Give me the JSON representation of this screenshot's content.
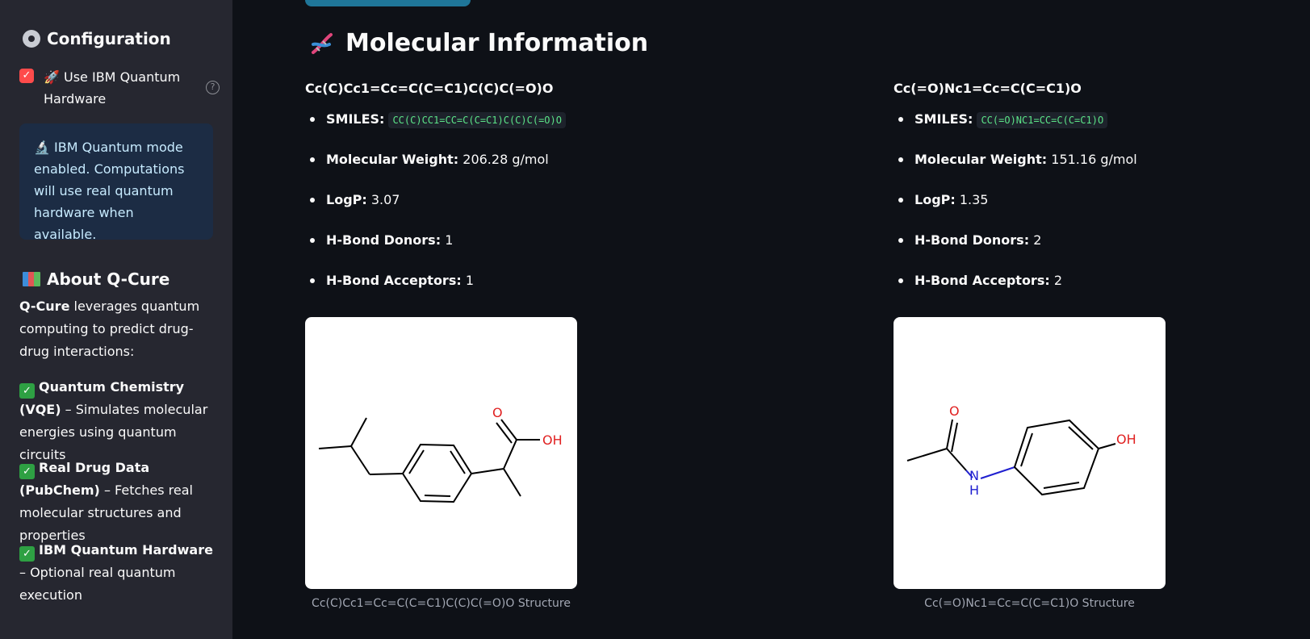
{
  "sidebar": {
    "config_title": "Configuration",
    "checkbox_label": "🚀 Use IBM Quantum Hardware",
    "checkbox_checked": true,
    "info_text": "🔬 IBM Quantum mode enabled. Computations will use real quantum hardware when available.",
    "about_title": "About Q-Cure",
    "about_intro_bold": "Q-Cure",
    "about_intro_rest": " leverages quantum computing to predict drug-drug interactions:",
    "features": [
      {
        "title": "Quantum Chemistry (VQE)",
        "desc": " – Simulates molecular energies using quantum circuits"
      },
      {
        "title": "Real Drug Data (PubChem)",
        "desc": " – Fetches real molecular structures and properties"
      },
      {
        "title": "IBM Quantum Hardware",
        "desc": " – Optional real quantum execution"
      }
    ]
  },
  "main": {
    "title": "Molecular Information",
    "molecules": [
      {
        "name": "Cc(C)Cc1=Cc=C(C=C1)C(C)C(=O)O",
        "smiles_label": "SMILES:",
        "smiles": "CC(C)CC1=CC=C(C=C1)C(C)C(=O)O",
        "mw_label": "Molecular Weight:",
        "mw": "206.28 g/mol",
        "logp_label": "LogP:",
        "logp": "3.07",
        "donors_label": "H-Bond Donors:",
        "donors": "1",
        "acceptors_label": "H-Bond Acceptors:",
        "acceptors": "1",
        "caption": "Cc(C)Cc1=Cc=C(C=C1)C(C)C(=O)O Structure",
        "atoms": [
          "O",
          "OH"
        ]
      },
      {
        "name": "Cc(=O)Nc1=Cc=C(C=C1)O",
        "smiles_label": "SMILES:",
        "smiles": "CC(=O)NC1=CC=C(C=C1)O",
        "mw_label": "Molecular Weight:",
        "mw": "151.16 g/mol",
        "logp_label": "LogP:",
        "logp": "1.35",
        "donors_label": "H-Bond Donors:",
        "donors": "2",
        "acceptors_label": "H-Bond Acceptors:",
        "acceptors": "2",
        "caption": "Cc(=O)Nc1=Cc=C(C=C1)O Structure",
        "atoms": [
          "O",
          "N",
          "H",
          "OH"
        ]
      }
    ]
  }
}
